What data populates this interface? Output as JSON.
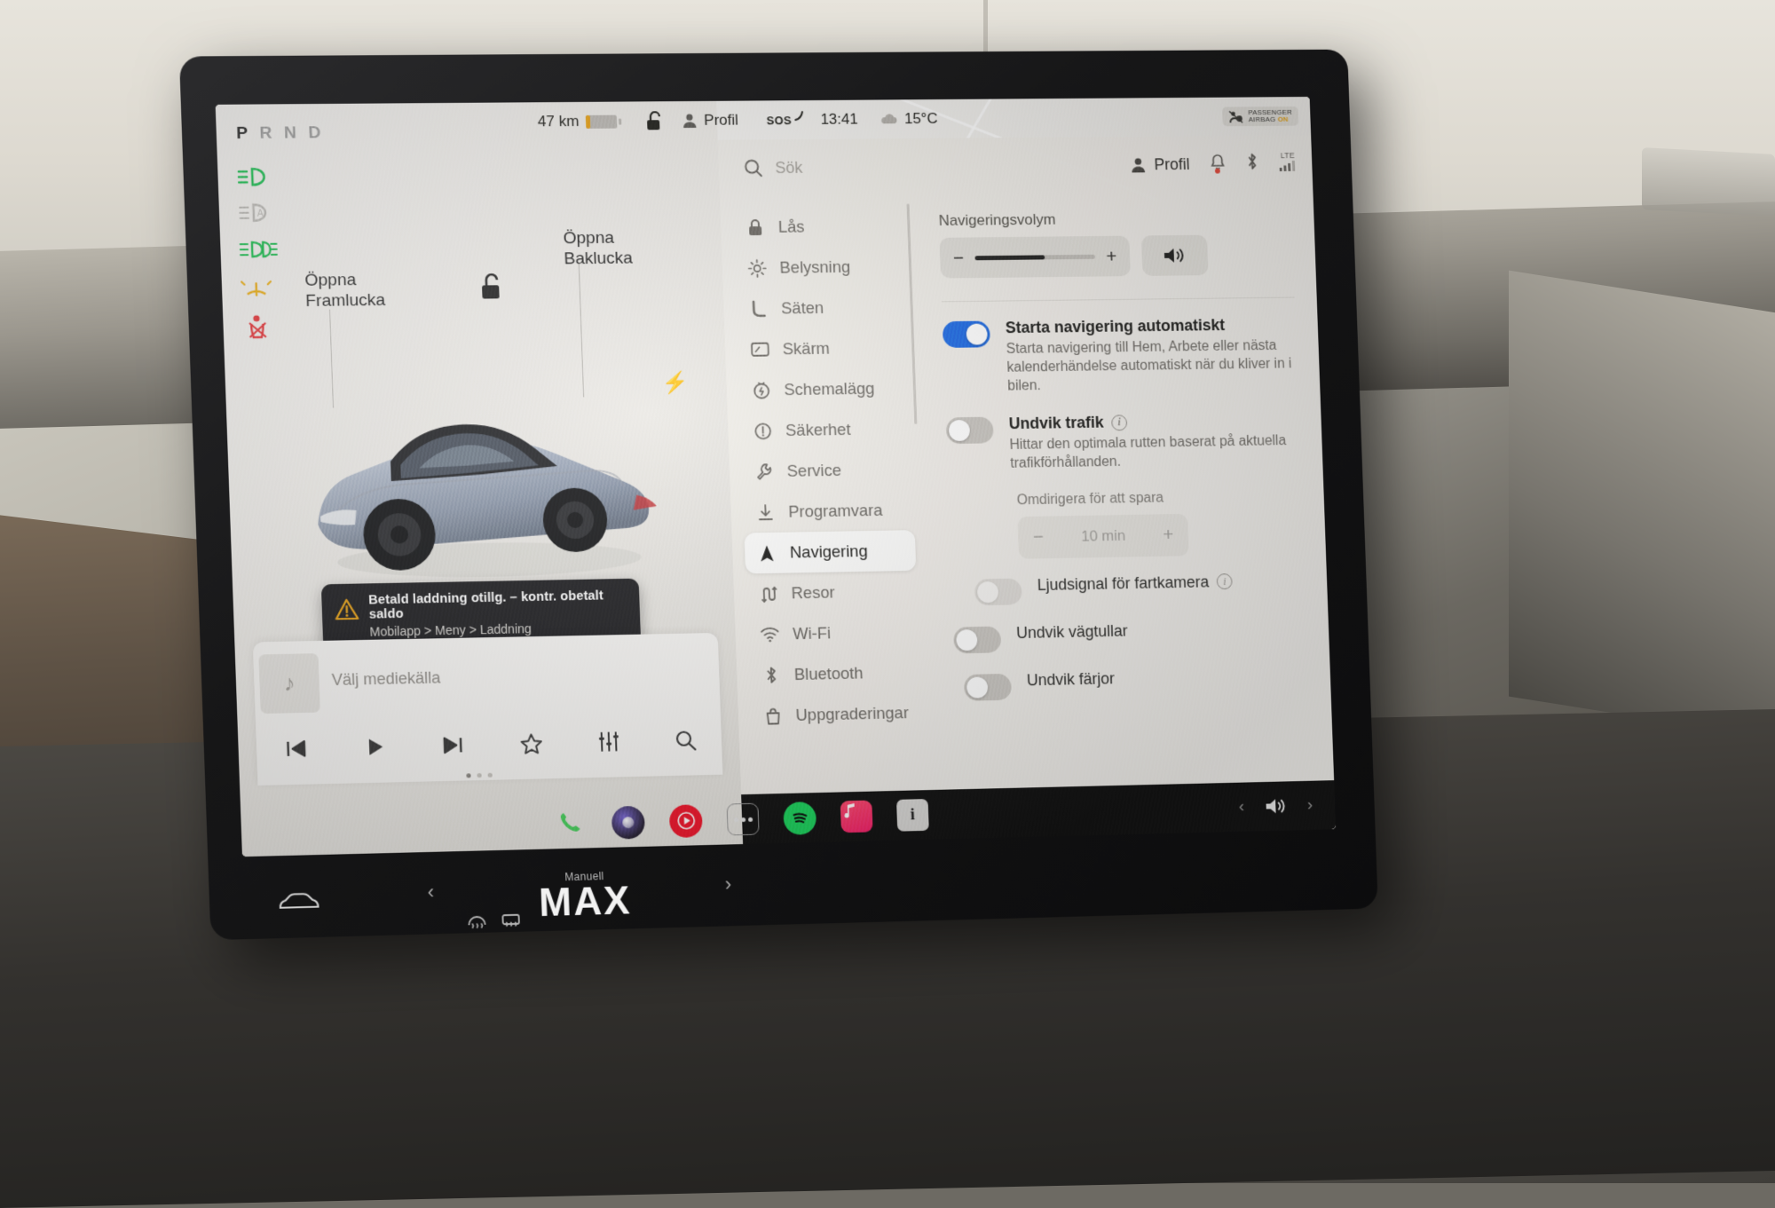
{
  "drive": {
    "gear_sequence": [
      "P",
      "R",
      "N",
      "D"
    ],
    "gear_selected": "P",
    "telltales": [
      {
        "name": "low-beam-headlight-indicator",
        "color": "#23b24b"
      },
      {
        "name": "auto-highbeam-indicator",
        "color": "#a9a7a2"
      },
      {
        "name": "front-fog-light-indicator",
        "color": "#23b24b"
      },
      {
        "name": "tire-pressure-warning",
        "color": "#e8a01c"
      },
      {
        "name": "seatbelt-warning",
        "color": "#e0373a"
      }
    ],
    "callout_front": {
      "line1": "Öppna",
      "line2": "Framlucka"
    },
    "callout_rear": {
      "line1": "Öppna",
      "line2": "Baklucka"
    },
    "range_text": "47 km",
    "battery_level_pct": 11,
    "battery_color": "#e8a01c"
  },
  "toast": {
    "title": "Betald laddning otillg. – kontr. obetalt saldo",
    "subtitle": "Mobilapp > Meny > Laddning",
    "icon": "warning-triangle-icon",
    "icon_color": "#e8a01c"
  },
  "media": {
    "source_placeholder": "Välj mediekälla",
    "art_icon": "music-note-icon",
    "controls": [
      {
        "name": "previous-track-button",
        "glyph": "⏮"
      },
      {
        "name": "play-button",
        "glyph": "▶"
      },
      {
        "name": "next-track-button",
        "glyph": "⏭"
      },
      {
        "name": "favorite-button",
        "glyph": "☆"
      },
      {
        "name": "equalizer-button",
        "glyph": "⦀"
      },
      {
        "name": "media-search-button",
        "glyph": "⌕"
      }
    ],
    "page_dots": 3,
    "page_active": 0
  },
  "statusbar": {
    "lock_icon": "unlocked-padlock-icon",
    "profile_label": "Profil",
    "sos_label": "SOS",
    "time": "13:41",
    "weather_icon": "cloud-icon",
    "temperature": "15°C",
    "airbag_line1": "PASSENGER",
    "airbag_line2": "AIRBAG",
    "airbag_state": "ON"
  },
  "toolbar": {
    "search_placeholder": "Sök",
    "profile_label": "Profil",
    "notification_icon": "bell-icon",
    "bluetooth_icon": "bluetooth-icon",
    "signal_label": "LTE"
  },
  "sidebar": {
    "items": [
      {
        "label": "Lås",
        "icon": "padlock-icon",
        "active": false
      },
      {
        "label": "Belysning",
        "icon": "brightness-icon",
        "active": false
      },
      {
        "label": "Säten",
        "icon": "seat-icon",
        "active": false
      },
      {
        "label": "Skärm",
        "icon": "display-icon",
        "active": false
      },
      {
        "label": "Schemalägg",
        "icon": "clock-bolt-icon",
        "active": false
      },
      {
        "label": "Säkerhet",
        "icon": "exclamation-circle-icon",
        "active": false
      },
      {
        "label": "Service",
        "icon": "wrench-icon",
        "active": false
      },
      {
        "label": "Programvara",
        "icon": "download-icon",
        "active": false
      },
      {
        "label": "Navigering",
        "icon": "navigation-arrow-icon",
        "active": true
      },
      {
        "label": "Resor",
        "icon": "route-icon",
        "active": false
      },
      {
        "label": "Wi-Fi",
        "icon": "wifi-icon",
        "active": false
      },
      {
        "label": "Bluetooth",
        "icon": "bluetooth-icon",
        "active": false
      },
      {
        "label": "Uppgraderingar",
        "icon": "shopping-bag-icon",
        "active": false
      }
    ]
  },
  "navigation_settings": {
    "volume_label": "Navigeringsvolym",
    "volume_pct": 58,
    "volume_minus": "−",
    "volume_plus": "+",
    "mute_icon": "speaker-icon",
    "auto_nav": {
      "title": "Starta navigering automatiskt",
      "description": "Starta navigering till Hem, Arbete eller nästa kalenderhändelse automatiskt när du kliver in i bilen.",
      "enabled": true
    },
    "avoid_traffic": {
      "title": "Undvik trafik",
      "description": "Hittar den optimala rutten baserat på aktuella trafikförhållanden.",
      "enabled": false,
      "has_info": true
    },
    "reroute": {
      "label": "Omdirigera för att spara",
      "value": "10 min",
      "minus": "−",
      "plus": "+",
      "disabled": true
    },
    "speed_camera": {
      "title": "Ljudsignal för fartkamera",
      "enabled": false,
      "has_info": true,
      "disabled": true
    },
    "avoid_tolls": {
      "title": "Undvik vägtullar",
      "enabled": false
    },
    "avoid_ferries": {
      "title": "Undvik färjor",
      "enabled": false
    }
  },
  "dock": {
    "apps": [
      {
        "name": "phone-app-icon"
      },
      {
        "name": "camera-app-icon"
      },
      {
        "name": "youtube-app-icon"
      },
      {
        "name": "more-apps-icon"
      },
      {
        "name": "spotify-app-icon"
      },
      {
        "name": "apple-music-app-icon"
      },
      {
        "name": "tidal-app-icon",
        "glyph": "i"
      }
    ],
    "prev_glyph": "‹",
    "next_glyph": "›",
    "volume_icon": "speaker-icon"
  },
  "climate": {
    "mode_label": "Manuell",
    "fan_value": "MAX",
    "left_arrow": "‹",
    "right_arrow": "›",
    "car_icon": "car-icon",
    "defrost_front_icon": "front-defrost-icon",
    "defrost_rear_icon": "rear-defrost-icon"
  }
}
